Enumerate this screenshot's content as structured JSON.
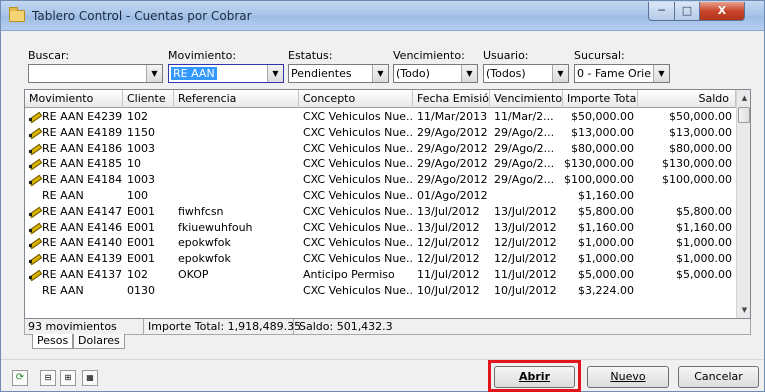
{
  "window": {
    "title": "Tablero Control - Cuentas por Cobrar",
    "min_glyph": "─",
    "max_glyph": "□",
    "close_glyph": "X"
  },
  "filters": [
    {
      "label": "Buscar:",
      "value": "",
      "highlighted": false
    },
    {
      "label": "Movimiento:",
      "value": "RE AAN",
      "highlighted": true
    },
    {
      "label": "Estatus:",
      "value": "Pendientes",
      "highlighted": false
    },
    {
      "label": "Vencimiento:",
      "value": "(Todo)",
      "highlighted": false
    },
    {
      "label": "Usuario:",
      "value": "(Todos)",
      "highlighted": false
    },
    {
      "label": "Sucursal:",
      "value": "0 - Fame Orie",
      "highlighted": false
    }
  ],
  "table": {
    "columns": [
      "Movimiento",
      "Cliente",
      "Referencia",
      "Concepto",
      "Fecha Emisión",
      "Vencimiento",
      "Importe Total",
      "Saldo"
    ],
    "rows": [
      {
        "icon": true,
        "movimiento": "RE AAN E4239",
        "cliente": "102",
        "referencia": "",
        "concepto": "CXC Vehiculos Nue...",
        "fecha": "11/Mar/2013",
        "venc": "11/Mar/2...",
        "importe": "$50,000.00",
        "saldo": "$50,000.00"
      },
      {
        "icon": true,
        "movimiento": "RE AAN E4189",
        "cliente": "1150",
        "referencia": "",
        "concepto": "CXC Vehiculos Nue...",
        "fecha": "29/Ago/2012",
        "venc": "29/Ago/2...",
        "importe": "$13,000.00",
        "saldo": "$13,000.00"
      },
      {
        "icon": true,
        "movimiento": "RE AAN E4186",
        "cliente": "1003",
        "referencia": "",
        "concepto": "CXC Vehiculos Nue...",
        "fecha": "29/Ago/2012",
        "venc": "29/Ago/2...",
        "importe": "$80,000.00",
        "saldo": "$80,000.00"
      },
      {
        "icon": true,
        "movimiento": "RE AAN E4185",
        "cliente": "10",
        "referencia": "",
        "concepto": "CXC Vehiculos Nue...",
        "fecha": "29/Ago/2012",
        "venc": "29/Ago/2...",
        "importe": "$130,000.00",
        "saldo": "$130,000.00"
      },
      {
        "icon": true,
        "movimiento": "RE AAN E4184",
        "cliente": "1003",
        "referencia": "",
        "concepto": "CXC Vehiculos Nue...",
        "fecha": "29/Ago/2012",
        "venc": "29/Ago/2...",
        "importe": "$100,000.00",
        "saldo": "$100,000.00"
      },
      {
        "icon": false,
        "movimiento": "RE AAN",
        "cliente": "100",
        "referencia": "",
        "concepto": "CXC Vehiculos Nue...",
        "fecha": "01/Ago/2012",
        "venc": "",
        "importe": "$1,160.00",
        "saldo": ""
      },
      {
        "icon": true,
        "movimiento": "RE AAN E4147",
        "cliente": "E001",
        "referencia": "fiwhfcsn",
        "concepto": "CXC Vehiculos Nue...",
        "fecha": "13/Jul/2012",
        "venc": "13/Jul/2012",
        "importe": "$5,800.00",
        "saldo": "$5,800.00"
      },
      {
        "icon": true,
        "movimiento": "RE AAN E4146",
        "cliente": "E001",
        "referencia": "fkiuewuhfouh",
        "concepto": "CXC Vehiculos Nue...",
        "fecha": "13/Jul/2012",
        "venc": "13/Jul/2012",
        "importe": "$1,160.00",
        "saldo": "$1,160.00"
      },
      {
        "icon": true,
        "movimiento": "RE AAN E4140",
        "cliente": "E001",
        "referencia": "epokwfok",
        "concepto": "CXC Vehiculos Nue...",
        "fecha": "12/Jul/2012",
        "venc": "12/Jul/2012",
        "importe": "$1,000.00",
        "saldo": "$1,000.00"
      },
      {
        "icon": true,
        "movimiento": "RE AAN E4139",
        "cliente": "E001",
        "referencia": "epokwfok",
        "concepto": "CXC Vehiculos Nue...",
        "fecha": "12/Jul/2012",
        "venc": "12/Jul/2012",
        "importe": "$1,000.00",
        "saldo": "$1,000.00"
      },
      {
        "icon": true,
        "movimiento": "RE AAN E4137",
        "cliente": "102",
        "referencia": "OKOP",
        "concepto": "Anticipo Permiso",
        "fecha": "11/Jul/2012",
        "venc": "11/Jul/2012",
        "importe": "$5,000.00",
        "saldo": "$5,000.00"
      },
      {
        "icon": false,
        "movimiento": "RE AAN",
        "cliente": "0130",
        "referencia": "",
        "concepto": "CXC Vehiculos Nue...",
        "fecha": "10/Jul/2012",
        "venc": "10/Jul/2012",
        "importe": "$3,224.00",
        "saldo": ""
      }
    ]
  },
  "status": {
    "count": "93 movimientos",
    "importe_total": "Importe Total: 1,918,489.35",
    "saldo": "Saldo: 501,432.3"
  },
  "tabs": [
    "Pesos",
    "Dolares"
  ],
  "buttons": {
    "abrir": "Abrir",
    "nuevo": "Nuevo",
    "cancelar": "Cancelar"
  },
  "colors": {
    "highlight": "#3399ff",
    "annotation_box": "#e2141c",
    "title_gradient": "#a9c5ea"
  }
}
